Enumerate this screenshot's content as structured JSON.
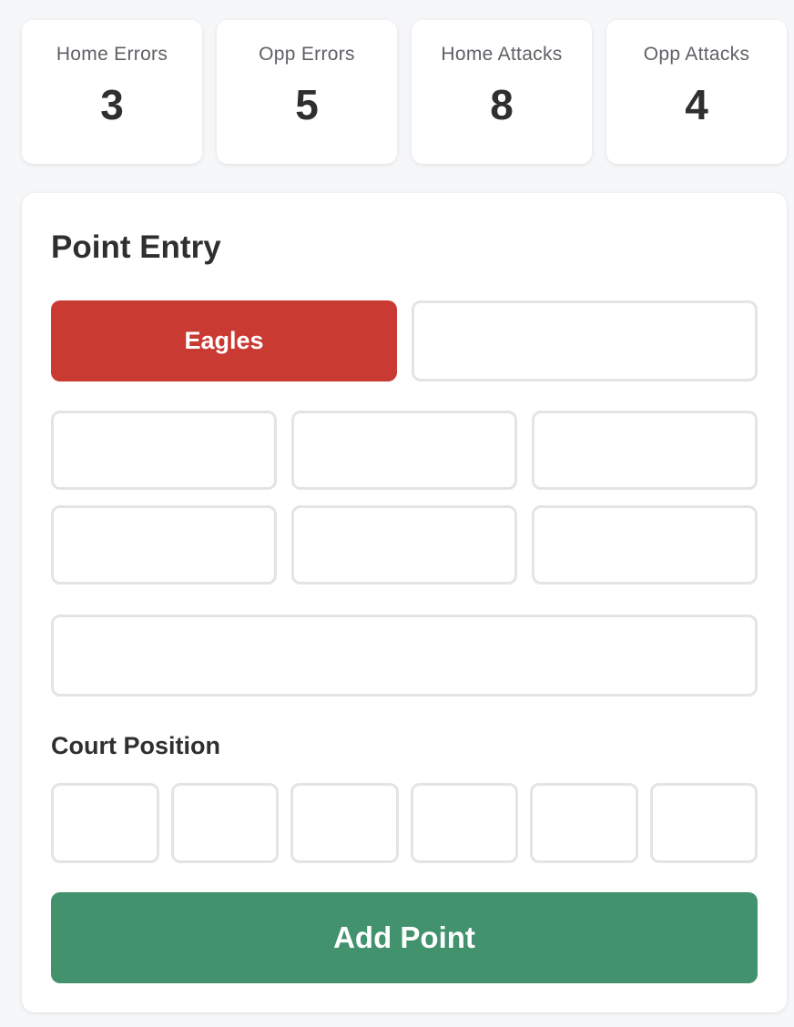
{
  "stats": [
    {
      "label": "Home Errors",
      "value": "3"
    },
    {
      "label": "Opp Errors",
      "value": "5"
    },
    {
      "label": "Home Attacks",
      "value": "8"
    },
    {
      "label": "Opp Attacks",
      "value": "4"
    }
  ],
  "point_entry": {
    "title": "Point Entry",
    "teams": {
      "home_label": "Eagles",
      "opp_label": ""
    },
    "selected_team": "Eagles",
    "court_position_label": "Court Position",
    "add_button_label": "Add Point"
  },
  "colors": {
    "selected_team": "#c93a33",
    "add_button": "#42926e",
    "outline": "#e3e4e7",
    "background": "#f6f7f9"
  }
}
